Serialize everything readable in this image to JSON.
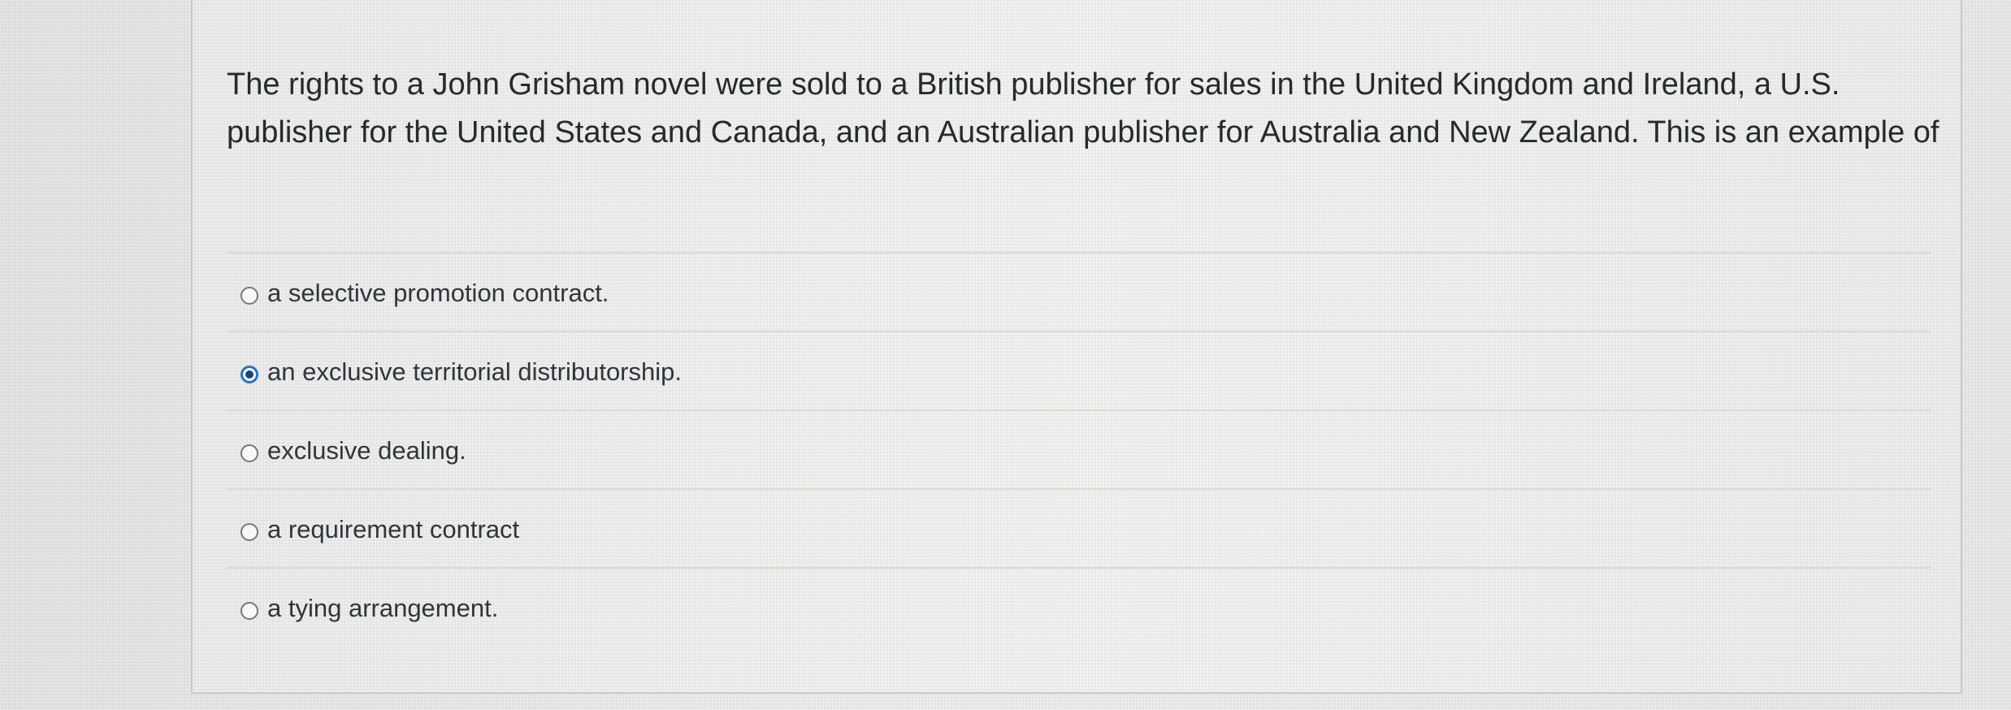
{
  "question": {
    "text": "The rights to a John Grisham novel were sold to a British publisher for sales in the United Kingdom and Ireland, a U.S. publisher for the United States and Canada, and an Australian publisher for Australia and New Zealand. This is an example of"
  },
  "options": [
    {
      "label": "a selective promotion contract.",
      "selected": false
    },
    {
      "label": "an exclusive territorial distributorship.",
      "selected": true
    },
    {
      "label": "exclusive dealing.",
      "selected": false
    },
    {
      "label": "a requirement contract",
      "selected": false
    },
    {
      "label": "a tying arrangement.",
      "selected": false
    }
  ],
  "colors": {
    "selected_radio": "#1f73d0",
    "text": "#252a2d",
    "divider": "#d7dbdc"
  }
}
